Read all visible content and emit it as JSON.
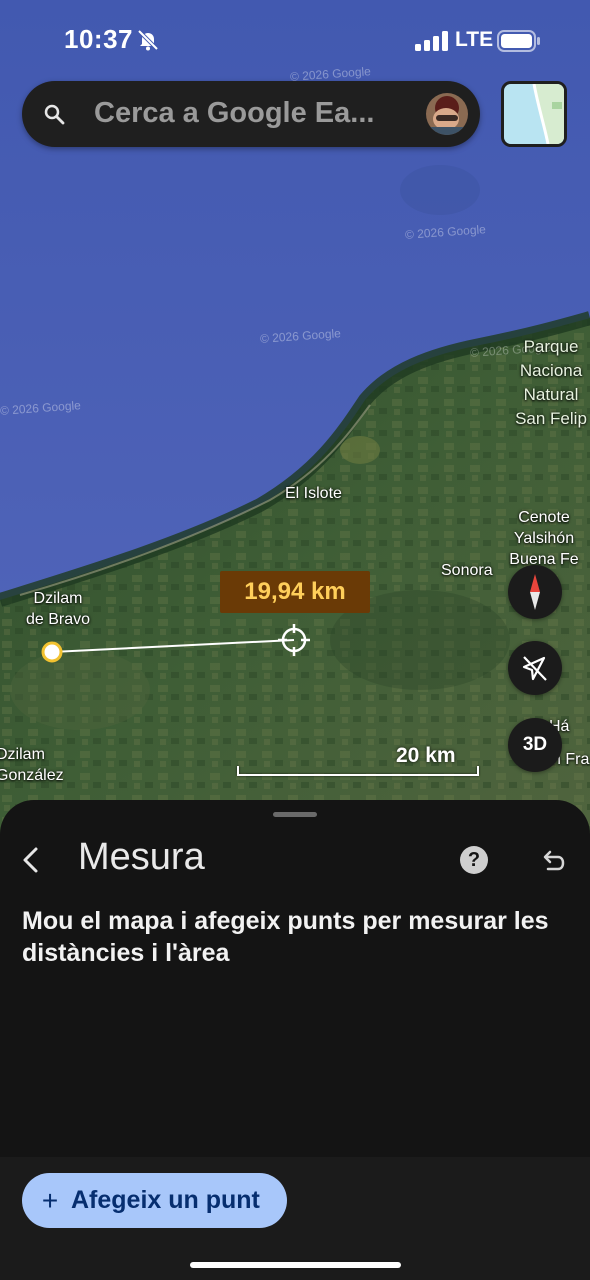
{
  "status_bar": {
    "time": "10:37",
    "network": "LTE"
  },
  "search": {
    "placeholder": "Cerca a Google Ea...",
    "icon": "search-icon"
  },
  "map": {
    "labels": [
      {
        "name": "label-parque-nacional",
        "text": "Parque\nNaciona\nNatural\nSan Felip"
      },
      {
        "name": "label-el-islote",
        "text": "El Islote"
      },
      {
        "name": "label-cenote",
        "text": "Cenote\nYalsihón\nBuena Fe"
      },
      {
        "name": "label-sonora",
        "text": "Sonora"
      },
      {
        "name": "label-dzilam-bravo",
        "text": "Dzilam\nde Bravo"
      },
      {
        "name": "label-dzilam-gonzalez",
        "text": "Dzilam\nGonzález"
      },
      {
        "name": "label-partial-ha",
        "text": "Há"
      },
      {
        "name": "label-partial-fra",
        "text": "n Fra"
      }
    ],
    "watermarks": [
      "© 2026 Google",
      "© 2026 Google",
      "© 2026 Google",
      "© 2026 Google",
      "© 2026 Google"
    ],
    "measurement": {
      "distance": "19,94 km",
      "accent": "#ffcf5a"
    },
    "scale": {
      "label": "20 km"
    },
    "controls": {
      "three_d": "3D"
    }
  },
  "sheet": {
    "title": "Mesura",
    "help": "?",
    "instructions": "Mou el mapa i afegeix punts per mesurar les distàncies i l'àrea",
    "add_point": {
      "icon": "+",
      "label": "Afegeix un punt"
    }
  },
  "colors": {
    "sea": "#4d63b8",
    "land": "#3e5a36",
    "sheet": "#141414",
    "button": "#a8c7fa"
  }
}
